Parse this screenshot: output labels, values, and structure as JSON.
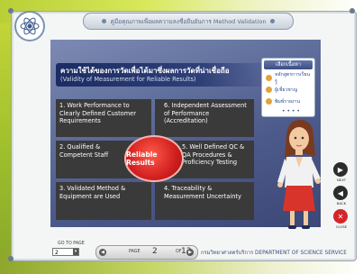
{
  "header": {
    "title": "คู่มือคุณภาพเพื่อผลความลงชื่อยืนยันการ Method Validation"
  },
  "slide": {
    "heading_th": "ความใช้ได้ของการวัดเพื่อได้มาซึ่งผลการวัดที่น่าเชื่อถือ",
    "heading_en": "(Validity of Measurement for Reliable Results)",
    "center": "Reliable Results",
    "quadrants": [
      "1. Work Performance to Clearly Defined Customer Requirements",
      "6. Independent Assessment of Performance (Accreditation)",
      "2. Qualified & Competent Staff",
      "5. Well Defined QC & QA Procedures & Proficiency Testing",
      "3. Validated Method & Equipment are Used",
      "4. Traceability & Measurement Uncertainty"
    ]
  },
  "menu": {
    "title": "เลือกเนื้อหา",
    "items": [
      "หลักสูตรการเรียนรู้",
      "ผู้เชี่ยวชาญ",
      "พิมพ์รายงาน"
    ],
    "dots": "• • • •"
  },
  "controls": {
    "next_label": "NEXT",
    "back_label": "BACK",
    "close_label": "CLOSE"
  },
  "footer": {
    "goto_label": "GO TO PAGE",
    "goto_value": "2",
    "page_label": "PAGE",
    "current_page": "2",
    "of_label": "OF",
    "total_pages": "13",
    "org": "กรมวิทยาศาสตร์บริการ   DEPARTMENT OF SCIENCE SERVICE"
  },
  "colors": {
    "accent_green": "#9fbf2c",
    "slide_blue": "#4d5b8c",
    "center_red": "#d11f1f"
  }
}
